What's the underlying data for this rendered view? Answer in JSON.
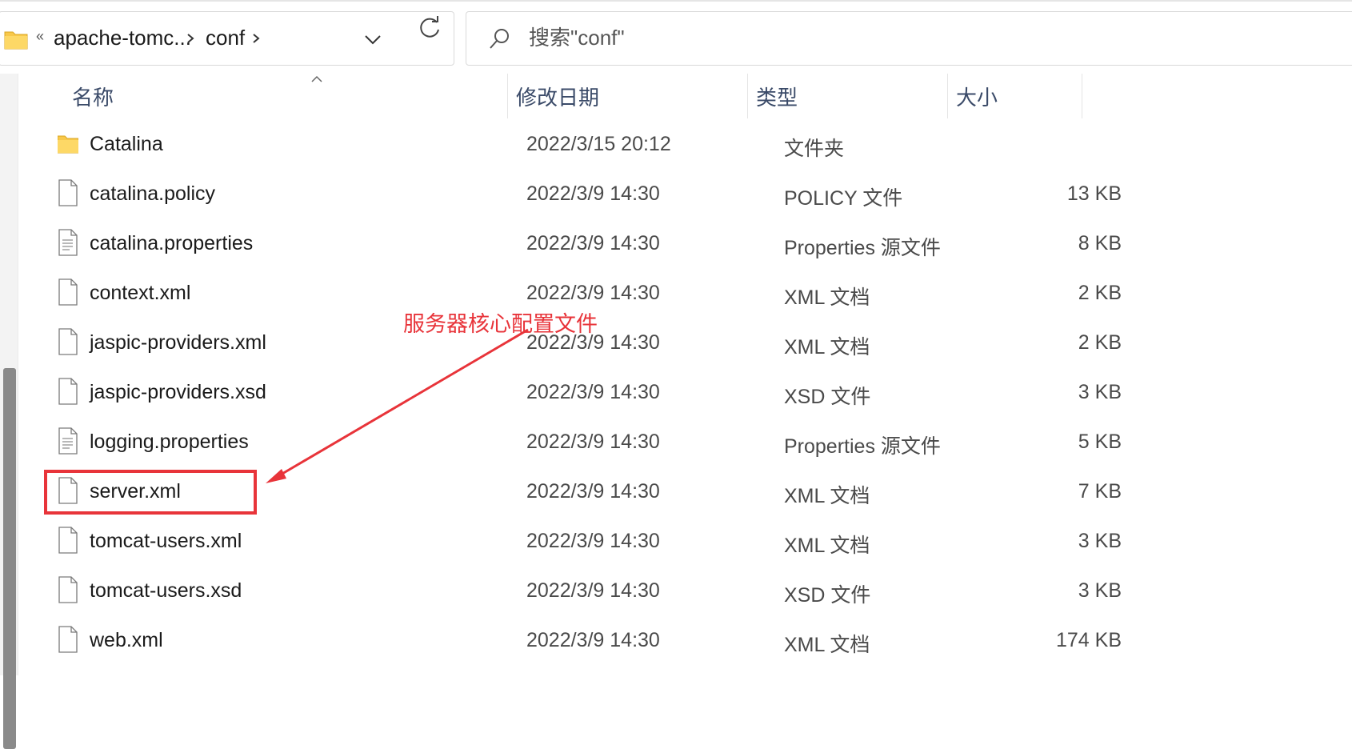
{
  "address_bar": {
    "overflow": "«",
    "crumbs": [
      "apache-tomc...",
      "conf"
    ]
  },
  "search": {
    "placeholder": "搜索\"conf\""
  },
  "columns": {
    "name": "名称",
    "date": "修改日期",
    "type": "类型",
    "size": "大小"
  },
  "files": [
    {
      "name": "Catalina",
      "date": "2022/3/15 20:12",
      "type": "文件夹",
      "size": "",
      "icon": "folder-icon"
    },
    {
      "name": "catalina.policy",
      "date": "2022/3/9 14:30",
      "type": "POLICY 文件",
      "size": "13 KB",
      "icon": "file-icon"
    },
    {
      "name": "catalina.properties",
      "date": "2022/3/9 14:30",
      "type": "Properties 源文件",
      "size": "8 KB",
      "icon": "text-file-icon"
    },
    {
      "name": "context.xml",
      "date": "2022/3/9 14:30",
      "type": "XML 文档",
      "size": "2 KB",
      "icon": "file-icon"
    },
    {
      "name": "jaspic-providers.xml",
      "date": "2022/3/9 14:30",
      "type": "XML 文档",
      "size": "2 KB",
      "icon": "file-icon"
    },
    {
      "name": "jaspic-providers.xsd",
      "date": "2022/3/9 14:30",
      "type": "XSD 文件",
      "size": "3 KB",
      "icon": "file-icon"
    },
    {
      "name": "logging.properties",
      "date": "2022/3/9 14:30",
      "type": "Properties 源文件",
      "size": "5 KB",
      "icon": "text-file-icon"
    },
    {
      "name": "server.xml",
      "date": "2022/3/9 14:30",
      "type": "XML 文档",
      "size": "7 KB",
      "icon": "file-icon"
    },
    {
      "name": "tomcat-users.xml",
      "date": "2022/3/9 14:30",
      "type": "XML 文档",
      "size": "3 KB",
      "icon": "file-icon"
    },
    {
      "name": "tomcat-users.xsd",
      "date": "2022/3/9 14:30",
      "type": "XSD 文件",
      "size": "3 KB",
      "icon": "file-icon"
    },
    {
      "name": "web.xml",
      "date": "2022/3/9 14:30",
      "type": "XML 文档",
      "size": "174 KB",
      "icon": "file-icon"
    }
  ],
  "annotation": {
    "text": "服务器核心配置文件",
    "color": "#e8343a"
  }
}
